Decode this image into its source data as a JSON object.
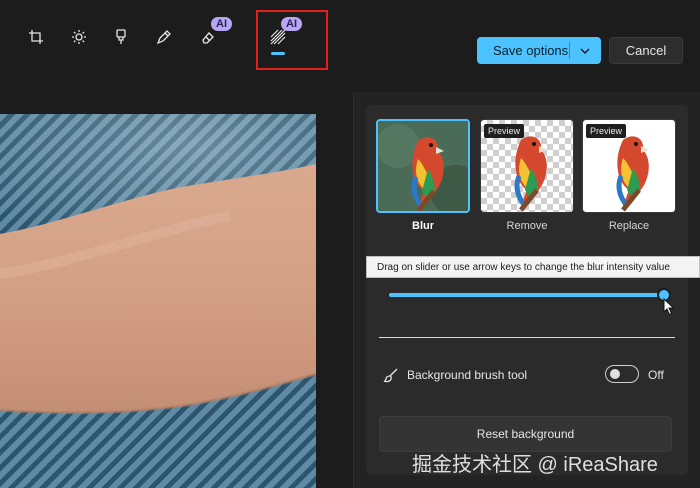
{
  "toolbar": {
    "tools": [
      {
        "name": "crop",
        "icon": "crop-icon"
      },
      {
        "name": "adjust",
        "icon": "brightness-icon"
      },
      {
        "name": "filter",
        "icon": "filter-icon"
      },
      {
        "name": "markup",
        "icon": "pen-icon"
      },
      {
        "name": "erase",
        "icon": "eraser-icon",
        "badge": "AI"
      },
      {
        "name": "background",
        "icon": "background-icon",
        "badge": "AI",
        "selected": true
      }
    ],
    "save_label": "Save options",
    "cancel_label": "Cancel"
  },
  "background_panel": {
    "options": [
      {
        "label": "Blur",
        "selected": true,
        "preview_tag": ""
      },
      {
        "label": "Remove",
        "selected": false,
        "preview_tag": "Preview"
      },
      {
        "label": "Replace",
        "selected": false,
        "preview_tag": "Preview"
      }
    ],
    "tooltip": "Drag on slider or use arrow keys to change the blur intensity value",
    "blur_intensity": 1.0,
    "brush_tool_label": "Background brush tool",
    "brush_toggle_state": "Off",
    "reset_label": "Reset background"
  },
  "watermark": "掘金技术社区 @ iReaShare",
  "colors": {
    "accent": "#4cc2ff",
    "highlight_box": "#e11d1d",
    "ai_badge": "#b9a7f5"
  }
}
